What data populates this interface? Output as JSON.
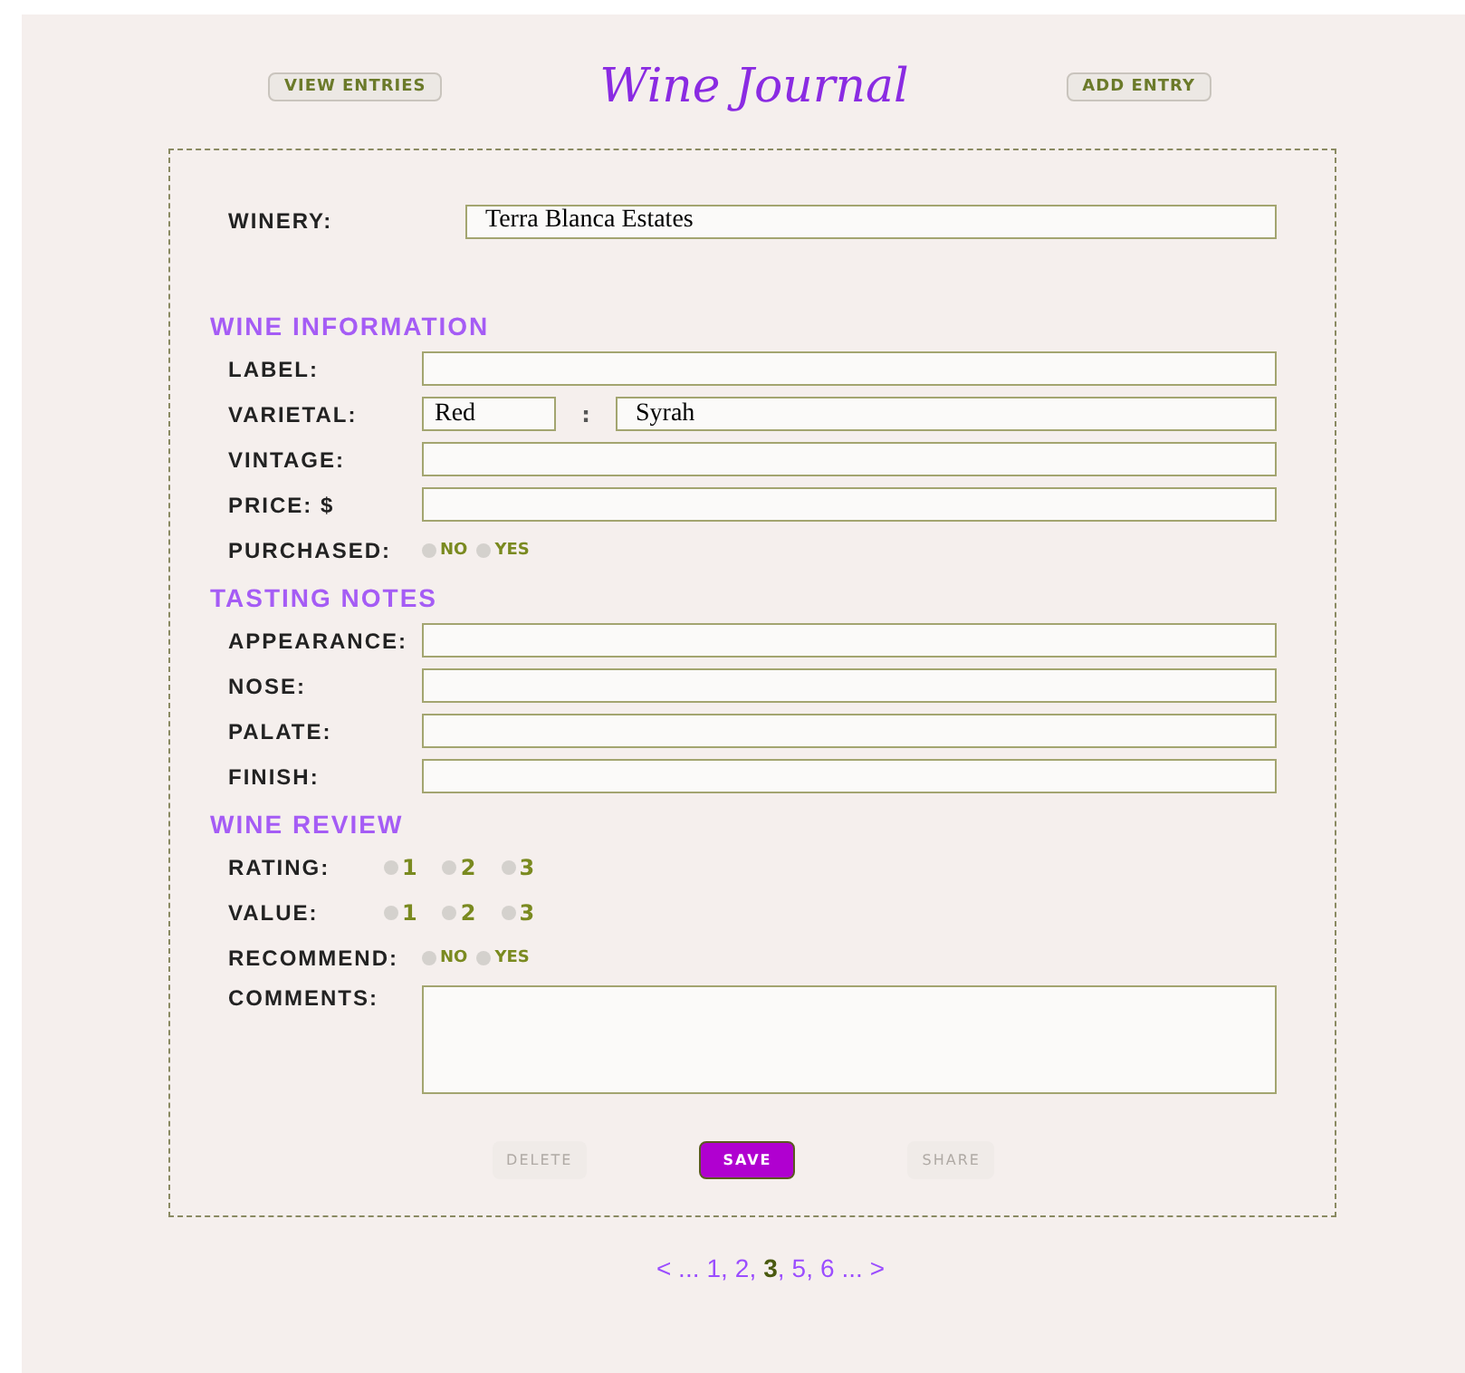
{
  "header": {
    "left_button": "VIEW ENTRIES",
    "title": "Wine Journal",
    "right_button": "ADD ENTRY"
  },
  "winery": {
    "label": "WINERY:",
    "value": "Terra Blanca Estates"
  },
  "sections": [
    {
      "heading": "WINE INFORMATION",
      "rows": [
        {
          "kind": "text",
          "label": "LABEL:"
        },
        {
          "kind": "pair",
          "label": "VARIETAL:",
          "first": "Red",
          "separator": ":",
          "second": "Syrah"
        },
        {
          "kind": "text",
          "label": "VINTAGE:"
        },
        {
          "kind": "text",
          "label": "PRICE: $"
        },
        {
          "kind": "radio",
          "label": "PURCHASED:",
          "options": [
            {
              "label": "NO",
              "selected": false
            },
            {
              "label": "YES",
              "selected": false
            }
          ]
        }
      ]
    },
    {
      "heading": "TASTING NOTES",
      "rows": [
        {
          "kind": "text",
          "label": "APPEARANCE:"
        },
        {
          "kind": "text",
          "label": "NOSE:"
        },
        {
          "kind": "text",
          "label": "PALATE:"
        },
        {
          "kind": "text",
          "label": "FINISH:"
        }
      ]
    },
    {
      "heading": "WINE REVIEW",
      "rows": [
        {
          "kind": "number",
          "label": "RATING:",
          "options": [
            {
              "label": "1",
              "selected": false
            },
            {
              "label": "2",
              "selected": false
            },
            {
              "label": "3",
              "selected": false
            }
          ]
        },
        {
          "kind": "number",
          "label": "VALUE:",
          "options": [
            {
              "label": "1",
              "selected": false
            },
            {
              "label": "2",
              "selected": false
            },
            {
              "label": "3",
              "selected": false
            }
          ]
        },
        {
          "kind": "radio",
          "label": "RECOMMEND:",
          "options": [
            {
              "label": "NO",
              "selected": false
            },
            {
              "label": "YES",
              "selected": false
            }
          ]
        },
        {
          "kind": "textarea",
          "label": "COMMENTS:"
        }
      ]
    }
  ],
  "buttons": [
    {
      "label": "DELETE",
      "kind": "plain",
      "disabled": true
    },
    {
      "label": "SAVE",
      "kind": "primary",
      "disabled": false
    },
    {
      "label": "SHARE",
      "kind": "plain",
      "disabled": true
    }
  ],
  "pagination": [
    {
      "kind": "nav",
      "text": "< ..."
    },
    {
      "kind": "page",
      "text": "1,",
      "selected": false
    },
    {
      "kind": "page",
      "text": "2,",
      "selected": false
    },
    {
      "kind": "page",
      "text": "3",
      "selected": true
    },
    {
      "kind": "sep",
      "text": ","
    },
    {
      "kind": "page",
      "text": "5,",
      "selected": false
    },
    {
      "kind": "page",
      "text": "6",
      "selected": false
    },
    {
      "kind": "nav",
      "text": "... >"
    }
  ]
}
